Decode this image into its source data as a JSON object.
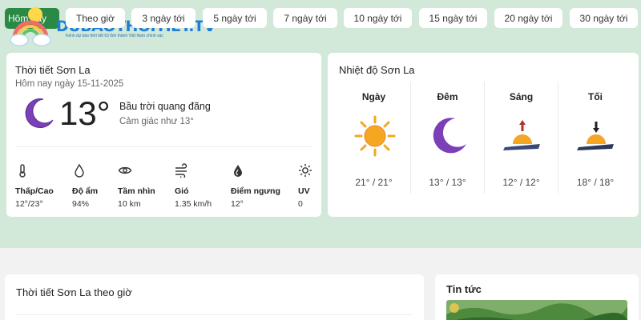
{
  "logo": {
    "button_label": "Hôm nay",
    "text": "DUBAOTHOITIET.TV",
    "subtext": "Kênh dự báo thời tiết 63 tỉnh thành Việt Nam chính xác"
  },
  "tabs": [
    "Theo giờ",
    "3 ngày tới",
    "5 ngày tới",
    "7 ngày tới",
    "10 ngày tới",
    "15 ngày tới",
    "20 ngày tới",
    "30 ngày tới"
  ],
  "current": {
    "title": "Thời tiết Sơn La",
    "date": "Hôm nay ngày 15-11-2025",
    "temperature": "13°",
    "description": "Bầu trời quang đãng",
    "feels_like": "Cảm giác như 13°",
    "icon": "crescent-moon-icon",
    "metrics": [
      {
        "icon": "thermometer-icon",
        "label": "Thấp/Cao",
        "value": "12°/23°"
      },
      {
        "icon": "droplet-icon",
        "label": "Độ ẩm",
        "value": "94%"
      },
      {
        "icon": "eye-icon",
        "label": "Tầm nhìn",
        "value": "10 km"
      },
      {
        "icon": "wind-icon",
        "label": "Gió",
        "value": "1.35 km/h"
      },
      {
        "icon": "dew-point-icon",
        "label": "Điểm ngưng",
        "value": "12°"
      },
      {
        "icon": "sun-uv-icon",
        "label": "UV",
        "value": "0"
      }
    ]
  },
  "temps": {
    "title": "Nhiệt độ Sơn La",
    "periods": [
      {
        "label": "Ngày",
        "icon": "sun-icon",
        "value": "21° / 21°"
      },
      {
        "label": "Đêm",
        "icon": "crescent-moon-icon",
        "value": "13° / 13°"
      },
      {
        "label": "Sáng",
        "icon": "sunrise-icon",
        "value": "12° / 12°"
      },
      {
        "label": "Tối",
        "icon": "sunset-icon",
        "value": "18° / 18°"
      }
    ]
  },
  "hourly": {
    "title": "Thời tiết Sơn La theo giờ"
  },
  "news": {
    "title": "Tin tức"
  },
  "colors": {
    "background": "#d2e8d8",
    "brand_green": "#2a8a45",
    "brand_blue": "#1f7fd8",
    "moon_purple": "#7b3fb8",
    "sun_orange": "#f5a623"
  }
}
